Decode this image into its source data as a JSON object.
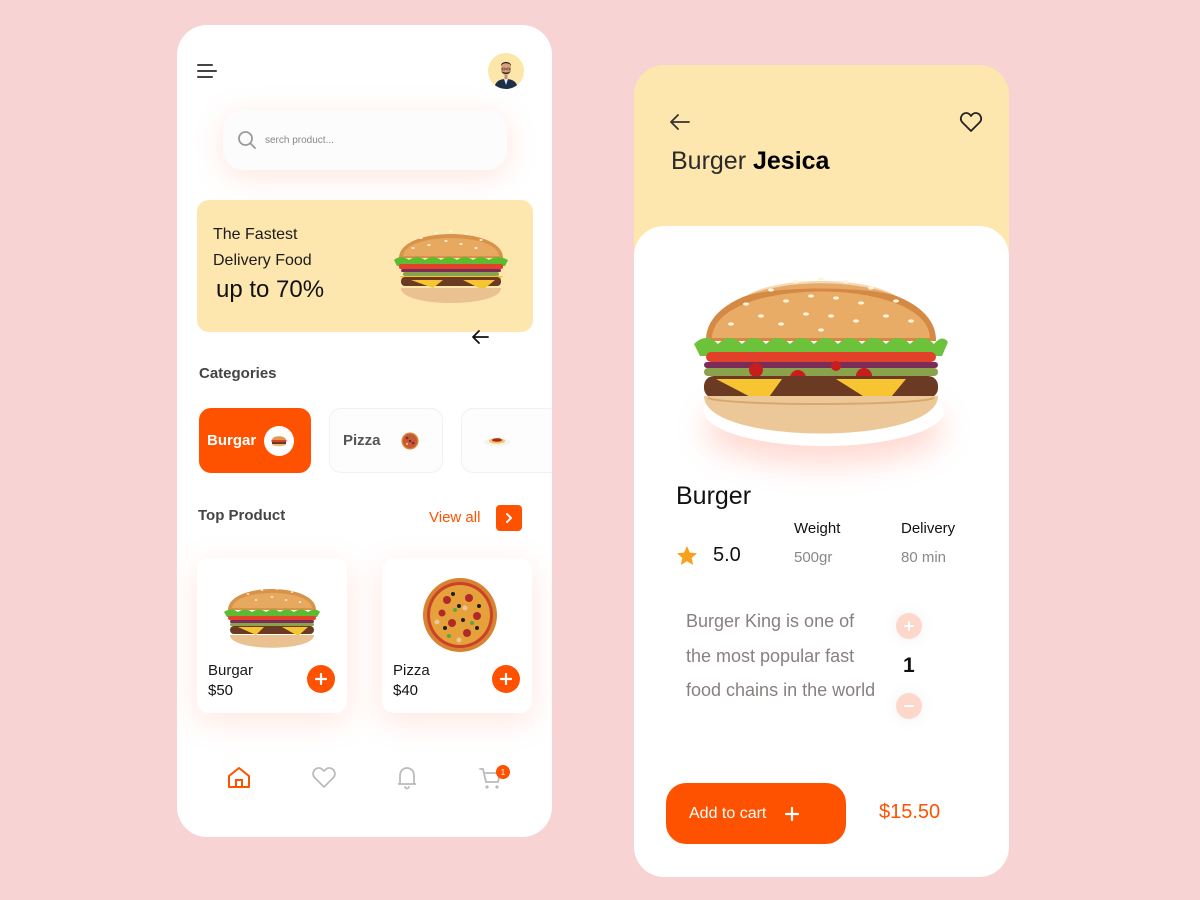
{
  "colors": {
    "background": "#f7d3d3",
    "accent": "#ff5200",
    "promo_bg": "#fde7ae",
    "star": "#f9a01b"
  },
  "home": {
    "search": {
      "placeholder": "serch product..."
    },
    "promo": {
      "line1": "The Fastest",
      "line2": "Delivery Food",
      "line3": "up to 70%"
    },
    "categories": {
      "title": "Categories",
      "items": [
        {
          "label": "Burgar",
          "icon": "burger-icon",
          "active": true
        },
        {
          "label": "Pizza",
          "icon": "pizza-icon",
          "active": false
        },
        {
          "label": "",
          "icon": "pasta-icon",
          "active": false
        }
      ]
    },
    "top_product": {
      "title": "Top Product",
      "view_all": "View all",
      "items": [
        {
          "name": "Burgar",
          "price": "$50",
          "icon": "burger-image"
        },
        {
          "name": "Pizza",
          "price": "$40",
          "icon": "pizza-image"
        }
      ]
    },
    "nav": {
      "items": [
        {
          "name": "home-icon",
          "active": true
        },
        {
          "name": "heart-icon",
          "active": false
        },
        {
          "name": "bell-icon",
          "active": false
        },
        {
          "name": "cart-icon",
          "active": false
        }
      ],
      "cart_badge": "1"
    }
  },
  "detail": {
    "title_light": "Burger",
    "title_bold": "Jesica",
    "product_name": "Burger",
    "rating": "5.0",
    "weight_label": "Weight",
    "weight_value": "500gr",
    "delivery_label": "Delivery",
    "delivery_value": "80 min",
    "description": "Burger King is one of the most popular fast food chains in the world",
    "quantity": "1",
    "add_to_cart": "Add to cart",
    "price": "$15.50"
  }
}
